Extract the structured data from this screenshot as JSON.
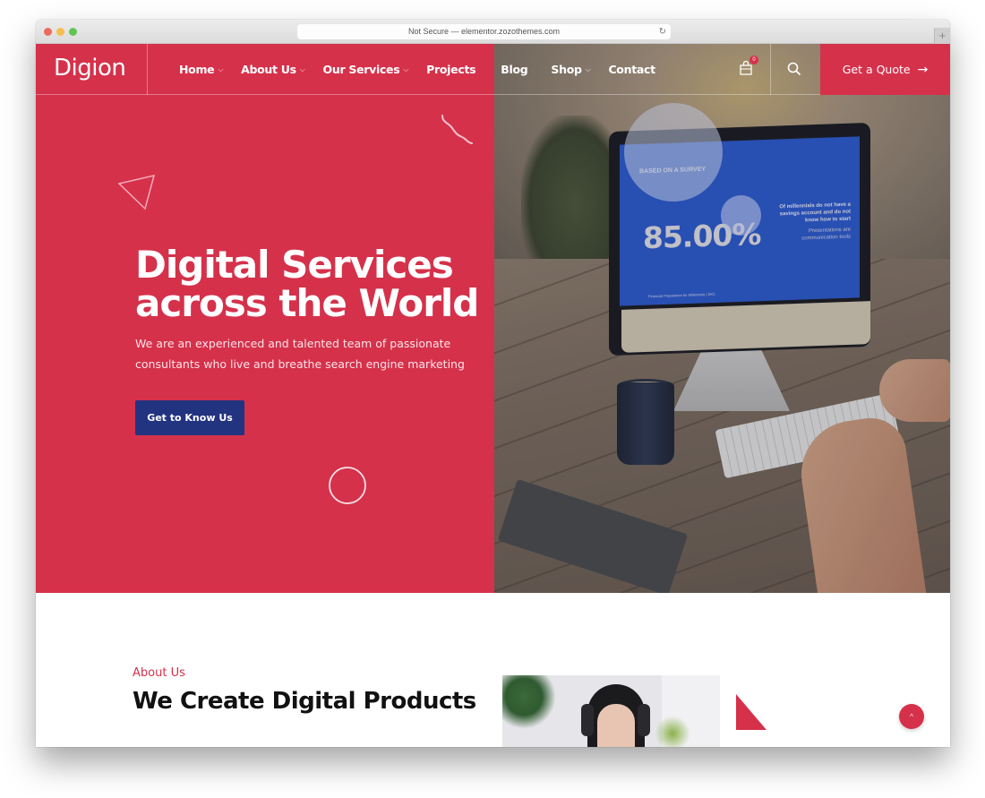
{
  "browser": {
    "url_text": "Not Secure — elementor.zozothemes.com",
    "reload_icon": "↻",
    "new_tab_icon": "+"
  },
  "header": {
    "logo": "Digion",
    "nav": [
      {
        "label": "Home",
        "has_dropdown": true
      },
      {
        "label": "About Us",
        "has_dropdown": true
      },
      {
        "label": "Our Services",
        "has_dropdown": true
      },
      {
        "label": "Projects",
        "has_dropdown": false
      },
      {
        "label": "Blog",
        "has_dropdown": false
      },
      {
        "label": "Shop",
        "has_dropdown": true
      },
      {
        "label": "Contact",
        "has_dropdown": false
      }
    ],
    "chevron": "⌵",
    "cart_count": "0",
    "quote_button": "Get a Quote",
    "quote_arrow": "→"
  },
  "hero": {
    "title_line1": "Digital Services",
    "title_line2": "across the World",
    "subtitle": "We are an experienced and talented team of passionate consultants who live and breathe search engine marketing",
    "cta": "Get to Know Us",
    "photo": {
      "screen_label": "BASED ON A SURVEY",
      "screen_stat": "85.00%",
      "screen_side_text": "Of millennials do not have a savings account and do not know how to start",
      "screen_side_text2": "Presentations are communication tools",
      "screen_footer": "Financial Preparation for Millennials | DKC"
    }
  },
  "about": {
    "label": "About Us",
    "title": "We Create Digital Products"
  },
  "scroll_top_icon": "^",
  "colors": {
    "brand_red": "#d5314b",
    "cta_navy": "#223380",
    "white": "#ffffff"
  }
}
